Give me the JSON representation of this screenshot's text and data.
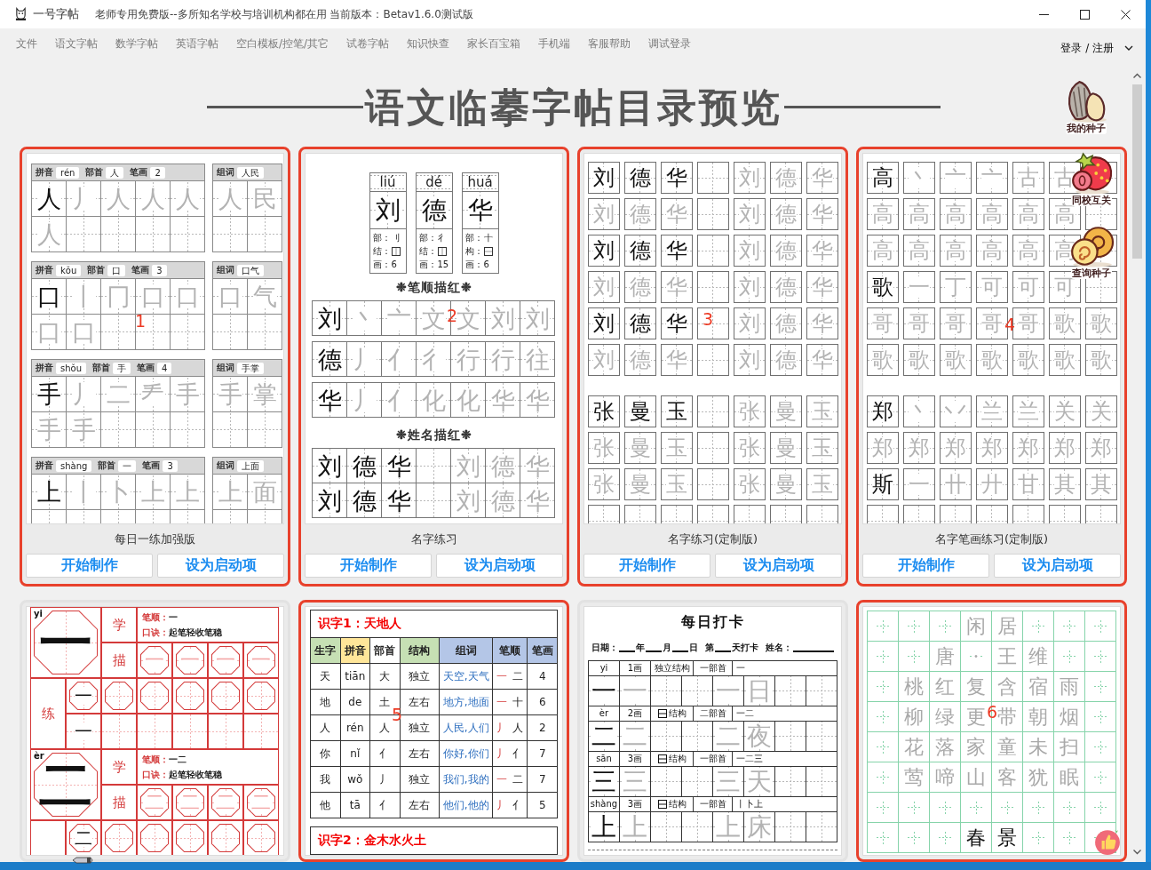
{
  "window": {
    "title": "一号字帖",
    "subtitle": "老师专用免费版--多所知名学校与培训机构都在用 当前版本：Betav1.6.0测试版"
  },
  "menu": {
    "items": [
      "文件",
      "语文字帖",
      "数学字帖",
      "英语字帖",
      "空白模板/控笔/其它",
      "试卷字帖",
      "知识快查",
      "家长百宝箱",
      "手机端",
      "客服帮助",
      "调试登录"
    ],
    "account": "登录 / 注册"
  },
  "page": {
    "heading": "语文临摹字帖目录预览"
  },
  "floating_buttons": [
    {
      "kind": "seed",
      "label": "我的种子"
    },
    {
      "kind": "strawberry",
      "label": "同校互关"
    },
    {
      "kind": "snail",
      "label": "查询种子"
    },
    {
      "kind": "like"
    }
  ],
  "cards": [
    {
      "kind": "daily",
      "title": "每日一练加强版",
      "highlighted": true,
      "marker": "1",
      "buttons": [
        "开始制作",
        "设为启动项"
      ],
      "preview": {
        "blocks": [
          {
            "fields": [
              {
                "label": "拼音",
                "value": "rén"
              },
              {
                "label": "部首",
                "value": "人"
              },
              {
                "label": "笔画",
                "value": "2"
              }
            ],
            "words": {
              "label": "组词",
              "value": "人民"
            },
            "rows": [
              {
                "model": [
                  "人"
                ],
                "trace": [
                  "丿",
                  "人",
                  "人",
                  "人"
                ]
              },
              {
                "trace": [
                  "人"
                ]
              }
            ],
            "word_rows": [
              {
                "trace": [
                  "人",
                  "民"
                ]
              }
            ]
          },
          {
            "fields": [
              {
                "label": "拼音",
                "value": "kǒu"
              },
              {
                "label": "部首",
                "value": "口"
              },
              {
                "label": "笔画",
                "value": "3"
              }
            ],
            "words": {
              "label": "组词",
              "value": "口气"
            },
            "rows": [
              {
                "model": [
                  "口"
                ],
                "trace": [
                  "丨",
                  "冂",
                  "口",
                  "口"
                ]
              },
              {
                "trace": [
                  "口",
                  "口"
                ]
              }
            ],
            "word_rows": [
              {
                "trace": [
                  "口",
                  "气"
                ]
              }
            ]
          },
          {
            "fields": [
              {
                "label": "拼音",
                "value": "shǒu"
              },
              {
                "label": "部首",
                "value": "手"
              },
              {
                "label": "笔画",
                "value": "4"
              }
            ],
            "words": {
              "label": "组词",
              "value": "手掌"
            },
            "rows": [
              {
                "model": [
                  "手"
                ],
                "trace": [
                  "丿",
                  "二",
                  "龵",
                  "手"
                ]
              },
              {
                "trace": [
                  "手",
                  "手"
                ]
              }
            ],
            "word_rows": [
              {
                "trace": [
                  "手",
                  "掌"
                ]
              }
            ]
          },
          {
            "fields": [
              {
                "label": "拼音",
                "value": "shàng"
              },
              {
                "label": "部首",
                "value": "一"
              },
              {
                "label": "笔画",
                "value": "3"
              }
            ],
            "words": {
              "label": "组词",
              "value": "上面"
            },
            "rows": [
              {
                "model": [
                  "上"
                ],
                "trace": [
                  "丨",
                  "卜",
                  "上",
                  "上"
                ]
              }
            ],
            "word_rows": [
              {
                "trace": [
                  "上",
                  "面"
                ]
              }
            ]
          }
        ]
      }
    },
    {
      "kind": "name",
      "title": "名字练习",
      "highlighted": true,
      "marker": "2",
      "buttons": [
        "开始制作",
        "设为启动项"
      ],
      "preview": {
        "name_cards": [
          {
            "pinyin": "liú",
            "char": "刘",
            "info": [
              {
                "kind": "text",
                "label": "部：",
                "value": "刂"
              },
              {
                "kind": "split",
                "label": "结："
              },
              {
                "kind": "text",
                "label": "画：",
                "value": "6"
              }
            ]
          },
          {
            "pinyin": "dé",
            "char": "德",
            "info": [
              {
                "kind": "text",
                "label": "部：",
                "value": "彳"
              },
              {
                "kind": "split",
                "label": "结："
              },
              {
                "kind": "text",
                "label": "画：",
                "value": "15"
              }
            ]
          },
          {
            "pinyin": "huá",
            "char": "华",
            "info": [
              {
                "kind": "text",
                "label": "部：",
                "value": "十"
              },
              {
                "kind": "stack",
                "label": "构："
              },
              {
                "kind": "text",
                "label": "画：",
                "value": "6"
              }
            ]
          }
        ],
        "sections": [
          {
            "heading": "❉笔顺描红❉",
            "rows": [
              {
                "model": [
                  "刘"
                ],
                "trace": [
                  "丶",
                  "亠",
                  "文",
                  "文",
                  "刘",
                  "刘"
                ]
              },
              {
                "model": [
                  "德"
                ],
                "trace": [
                  "丿",
                  "亻",
                  "彳",
                  "行",
                  "行",
                  "往"
                ]
              },
              {
                "model": [
                  "华"
                ],
                "trace": [
                  "丿",
                  "亻",
                  "化",
                  "化",
                  "华",
                  "华"
                ]
              }
            ]
          },
          {
            "heading": "❉姓名描红❉",
            "rows": [
              {
                "dark": true,
                "left": [
                  "刘",
                  "德",
                  "华"
                ],
                "right": [
                  "刘",
                  "德",
                  "华"
                ]
              },
              {
                "dark": true,
                "left": [
                  "刘",
                  "德",
                  "华"
                ],
                "right": [
                  "刘",
                  "德",
                  "华"
                ]
              }
            ]
          }
        ]
      }
    },
    {
      "kind": "name-grid",
      "title": "名字练习(定制版)",
      "highlighted": true,
      "marker": "3",
      "buttons": [
        "开始制作",
        "设为启动项"
      ],
      "preview": {
        "groups": [
          {
            "rows": [
              {
                "dark": true,
                "left": [
                  "刘",
                  "德",
                  "华"
                ],
                "right": [
                  "刘",
                  "德",
                  "华"
                ]
              },
              {
                "dark": false,
                "left": [
                  "刘",
                  "德",
                  "华"
                ],
                "right": [
                  "刘",
                  "德",
                  "华"
                ]
              },
              {
                "dark": true,
                "left": [
                  "刘",
                  "德",
                  "华"
                ],
                "right": [
                  "刘",
                  "德",
                  "华"
                ]
              },
              {
                "dark": false,
                "left": [
                  "刘",
                  "德",
                  "华"
                ],
                "right": [
                  "刘",
                  "德",
                  "华"
                ]
              },
              {
                "dark": true,
                "left": [
                  "刘",
                  "德",
                  "华"
                ],
                "right": [
                  "刘",
                  "德",
                  "华"
                ]
              },
              {
                "dark": false,
                "left": [
                  "刘",
                  "德",
                  "华"
                ],
                "right": [
                  "刘",
                  "德",
                  "华"
                ]
              }
            ]
          },
          {
            "rows": [
              {
                "dark": true,
                "left": [
                  "张",
                  "曼",
                  "玉"
                ],
                "right": [
                  "张",
                  "曼",
                  "玉"
                ]
              },
              {
                "dark": false,
                "left": [
                  "张",
                  "曼",
                  "玉"
                ],
                "right": [
                  "张",
                  "曼",
                  "玉"
                ]
              },
              {
                "dark": false,
                "left": [
                  "张",
                  "曼",
                  "玉"
                ],
                "right": [
                  "张",
                  "曼",
                  "玉"
                ]
              }
            ]
          }
        ]
      }
    },
    {
      "kind": "name-stroke",
      "title": "名字笔画练习(定制版)",
      "highlighted": true,
      "marker": "4",
      "buttons": [
        "开始制作",
        "设为启动项"
      ],
      "preview": {
        "groups": [
          {
            "rows": [
              {
                "model": [
                  "高"
                ],
                "trace": [
                  "丶",
                  "亠",
                  "亠",
                  "古",
                  "古"
                ]
              },
              {
                "trace": [
                  "高",
                  "高",
                  "高",
                  "高",
                  "高",
                  "高"
                ]
              },
              {
                "trace": [
                  "高",
                  "高",
                  "高",
                  "高",
                  "高",
                  "高"
                ]
              },
              {
                "model": [
                  "歌"
                ],
                "trace": [
                  "一",
                  "丁",
                  "可",
                  "可",
                  "可"
                ]
              },
              {
                "trace": [
                  "哥",
                  "哥",
                  "哥",
                  "哥",
                  "哥",
                  "歌",
                  "歌"
                ]
              },
              {
                "trace": [
                  "歌",
                  "歌",
                  "歌",
                  "歌",
                  "歌",
                  "歌",
                  "歌"
                ]
              }
            ]
          },
          {
            "rows": [
              {
                "model": [
                  "郑"
                ],
                "trace": [
                  "丶",
                  "丷",
                  "兰",
                  "兰",
                  "关",
                  "关"
                ]
              },
              {
                "trace": [
                  "郑",
                  "郑",
                  "郑",
                  "郑",
                  "郑",
                  "郑",
                  "郑"
                ]
              },
              {
                "model": [
                  "斯"
                ],
                "trace": [
                  "一",
                  "卄",
                  "廾",
                  "甘",
                  "其",
                  "其"
                ]
              }
            ]
          }
        ]
      }
    },
    {
      "kind": "stroke-sheet",
      "highlighted": false,
      "preview": {
        "blocks": [
          {
            "pinyin": "yi",
            "char": "一",
            "learn": "学",
            "trace_label": "描",
            "practice_label": "练",
            "order": {
              "label": "笔顺：",
              "value": "一"
            },
            "rhyme": {
              "label": "口诀：",
              "value": "起笔轻收笔稳"
            },
            "trace": [
              "一",
              "一",
              "一",
              "一"
            ],
            "practice": [
              "一",
              "一"
            ]
          },
          {
            "pinyin": "èr",
            "char": "二",
            "learn": "学",
            "trace_label": "描",
            "order": {
              "label": "笔顺：",
              "value": "一二"
            },
            "rhyme": {
              "label": "口诀：",
              "value": "起笔轻收笔稳"
            },
            "trace": [
              "二",
              "二",
              "二",
              "二"
            ],
            "practice": [
              "二"
            ]
          }
        ]
      }
    },
    {
      "kind": "lesson-table",
      "highlighted": true,
      "marker": "5",
      "preview": {
        "lessons": [
          {
            "title": "识字1：天地人",
            "columns": [
              {
                "label": "生字",
                "color": "#c6e0b4"
              },
              {
                "label": "拼音",
                "color": "#ffe699"
              },
              {
                "label": "部首",
                "color": "#ffffff"
              },
              {
                "label": "结构",
                "color": "#c6e0b4"
              },
              {
                "label": "组词",
                "color": "#b4c6e7"
              },
              {
                "label": "笔顺",
                "color": "#b4c6e7"
              },
              {
                "label": "笔画",
                "color": "#b4c6e7"
              }
            ],
            "rows": [
              {
                "char": "天",
                "pinyin": "tiān",
                "radical": "大",
                "structure": "独立",
                "words": "天空,天气",
                "order": [
                  "一",
                  "二"
                ],
                "strokes": "4"
              },
              {
                "char": "地",
                "pinyin": "de",
                "radical": "土",
                "structure": "左右",
                "words": "地方,地面",
                "order": [
                  "一",
                  "十"
                ],
                "strokes": "6"
              },
              {
                "char": "人",
                "pinyin": "rén",
                "radical": "人",
                "structure": "独立",
                "words": "人民,人们",
                "order": [
                  "丿",
                  "人"
                ],
                "strokes": "2"
              },
              {
                "char": "你",
                "pinyin": "nǐ",
                "radical": "亻",
                "structure": "左右",
                "words": "你好,你们",
                "order": [
                  "丿",
                  "亻"
                ],
                "strokes": "7"
              },
              {
                "char": "我",
                "pinyin": "wǒ",
                "radical": "丿",
                "structure": "独立",
                "words": "我们,我的",
                "order": [
                  "一",
                  "二"
                ],
                "strokes": "7"
              },
              {
                "char": "他",
                "pinyin": "tā",
                "radical": "亻",
                "structure": "左右",
                "words": "他们,他的",
                "order": [
                  "丿",
                  "亻"
                ],
                "strokes": "5"
              }
            ]
          },
          {
            "title": "识字2：金木水火土"
          }
        ]
      }
    },
    {
      "kind": "checkin",
      "highlighted": false,
      "preview": {
        "title": "每日打卡",
        "line": [
          {
            "kind": "text",
            "text": "日期："
          },
          {
            "kind": "blank"
          },
          {
            "kind": "text",
            "text": "年"
          },
          {
            "kind": "blank"
          },
          {
            "kind": "text",
            "text": "月"
          },
          {
            "kind": "blank"
          },
          {
            "kind": "text",
            "text": "日"
          },
          {
            "kind": "text",
            "text": "第"
          },
          {
            "kind": "blank"
          },
          {
            "kind": "text",
            "text": "天打卡"
          },
          {
            "kind": "text",
            "text": "姓名："
          },
          {
            "kind": "blank"
          }
        ],
        "blocks": [
          {
            "pinyin": "yi",
            "strokes": "1画",
            "structure_icon": false,
            "structure": "独立结构",
            "radical": "一部首",
            "order": "一",
            "model": "一",
            "copy": "一",
            "word": [
              "一",
              "日"
            ]
          },
          {
            "pinyin": "èr",
            "strokes": "2画",
            "structure_icon": true,
            "structure": "结构",
            "radical": "二部首",
            "order": "一二",
            "model": "二",
            "copy": "二",
            "word": [
              "二",
              "夜"
            ]
          },
          {
            "pinyin": "sān",
            "strokes": "3画",
            "structure_icon": true,
            "structure": "结构",
            "radical": "一部首",
            "order": "一二三",
            "model": "三",
            "copy": "三",
            "word": [
              "三",
              "天"
            ]
          },
          {
            "pinyin": "shàng",
            "strokes": "3画",
            "structure_icon": true,
            "structure": "结构",
            "radical": "一部首",
            "order": "丨卜上",
            "model": "上",
            "copy": "上",
            "word": [
              "上",
              "床"
            ]
          }
        ]
      }
    },
    {
      "kind": "poem-grid",
      "highlighted": true,
      "marker": "6",
      "preview": {
        "title": [
          "闲",
          "居"
        ],
        "author": [
          "唐",
          "·",
          "王",
          "维"
        ],
        "lines": [
          [
            "桃",
            "红",
            "复",
            "含",
            "宿",
            "雨"
          ],
          [
            "柳",
            "绿",
            "更",
            "带",
            "朝",
            "烟"
          ],
          [
            "花",
            "落",
            "家",
            "童",
            "未",
            "扫"
          ],
          [
            "莺",
            "啼",
            "山",
            "客",
            "犹",
            "眠"
          ]
        ],
        "next_title": [
          "春",
          "景"
        ]
      }
    }
  ]
}
